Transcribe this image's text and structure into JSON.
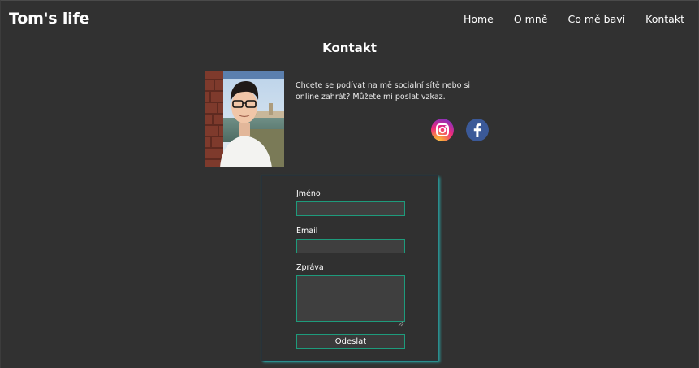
{
  "header": {
    "brand": "Tom's life",
    "nav": [
      {
        "label": "Home"
      },
      {
        "label": "O mně"
      },
      {
        "label": "Co mě baví"
      },
      {
        "label": "Kontakt"
      }
    ]
  },
  "main": {
    "title": "Kontakt",
    "intro_text": "Chcete se podívat na mě socialní sítě nebo si online zahrát? Můžete mi poslat vzkaz.",
    "social": [
      {
        "icon": "instagram-icon"
      },
      {
        "icon": "facebook-icon"
      }
    ]
  },
  "form": {
    "name_label": "Jméno",
    "name_value": "",
    "email_label": "Email",
    "email_value": "",
    "message_label": "Zpráva",
    "message_value": "",
    "submit_label": "Odeslat"
  },
  "colors": {
    "background": "#313131",
    "accent": "#1e9b7c",
    "facebook": "#3b5998"
  }
}
